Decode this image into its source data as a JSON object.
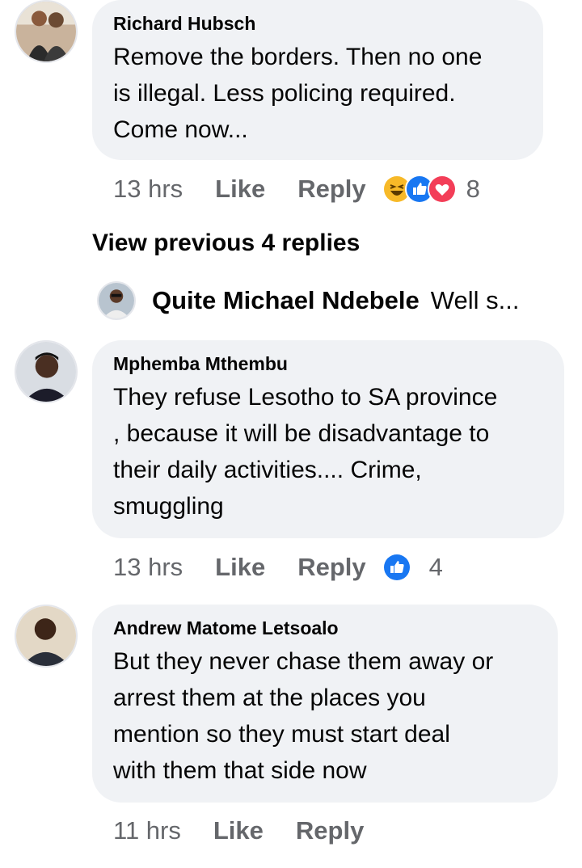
{
  "comments": [
    {
      "author": "Richard Hubsch",
      "lines": [
        "Remove the borders. Then no one",
        "is illegal. Less policing required.",
        "Come now..."
      ],
      "time": "13 hrs",
      "like": "Like",
      "reply": "Reply",
      "reactions": [
        "haha-icon",
        "like-icon",
        "love-icon"
      ],
      "reaction_count": "8"
    },
    {
      "author": "Mphemba Mthembu",
      "lines": [
        "They refuse Lesotho to SA province",
        ", because it will be disadvantage to",
        "their daily activities.... Crime,",
        "smuggling"
      ],
      "time": "13 hrs",
      "like": "Like",
      "reply": "Reply",
      "reactions": [
        "like-icon"
      ],
      "reaction_count": "4"
    },
    {
      "author": "Andrew Matome Letsoalo",
      "lines": [
        "But they never chase them away or",
        "arrest them at the places you",
        "mention so they must start deal",
        "with them that side now"
      ],
      "time": "11 hrs",
      "like": "Like",
      "reply": "Reply"
    }
  ],
  "view_previous": "View previous 4 replies",
  "collapsed_reply": {
    "author": "Quite Michael Ndebele",
    "preview": "Well s..."
  },
  "colors": {
    "bubble": "#f0f2f5",
    "meta_text": "#65676b",
    "like_blue": "#1877f2",
    "love_red": "#f33e58",
    "haha_yellow": "#f7b928"
  }
}
